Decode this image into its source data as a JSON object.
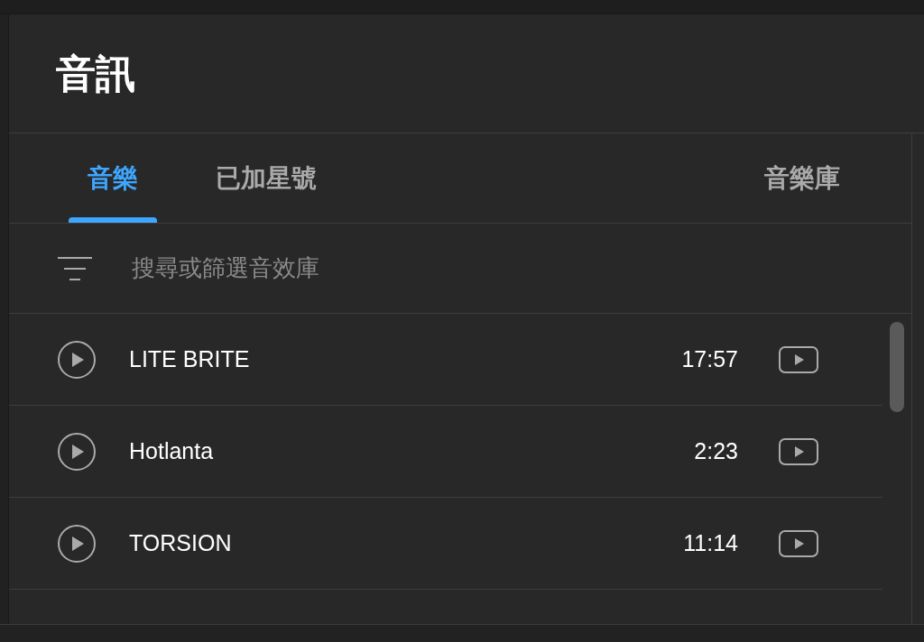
{
  "title": "音訊",
  "tabs": [
    {
      "label": "音樂",
      "selected": true
    },
    {
      "label": "已加星號",
      "selected": false
    },
    {
      "label": "音樂庫",
      "selected": false
    }
  ],
  "search": {
    "placeholder": "搜尋或篩選音效庫"
  },
  "tracks": [
    {
      "title": "LITE BRITE",
      "duration": "17:57"
    },
    {
      "title": "Hotlanta",
      "duration": "2:23"
    },
    {
      "title": "TORSION",
      "duration": "11:14"
    }
  ]
}
